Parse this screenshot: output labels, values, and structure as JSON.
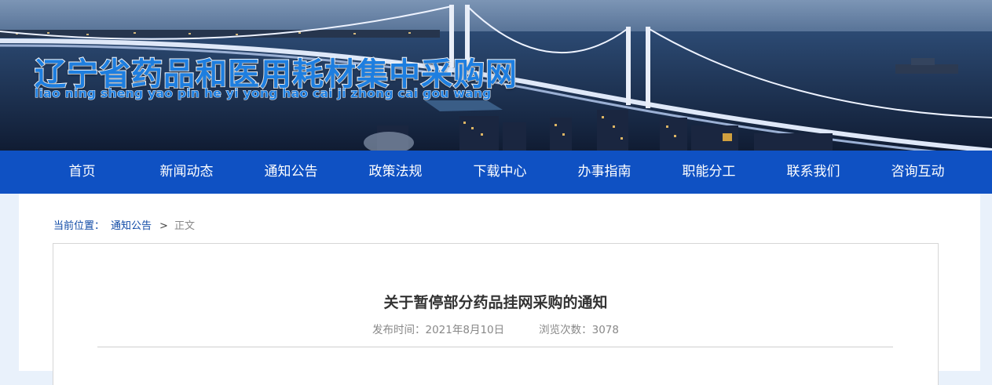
{
  "site": {
    "title": "辽宁省药品和医用耗材集中采购网",
    "pinyin": "liao ning sheng yao pin he yi yong hao cai ji zhong cai gou wang"
  },
  "nav": {
    "items": [
      "首页",
      "新闻动态",
      "通知公告",
      "政策法规",
      "下载中心",
      "办事指南",
      "职能分工",
      "联系我们",
      "咨询互动"
    ]
  },
  "breadcrumb": {
    "label": "当前位置：",
    "link": "通知公告",
    "separator": ">",
    "current": "正文"
  },
  "article": {
    "title": "关于暂停部分药品挂网采购的通知",
    "publish_label": "发布时间：",
    "publish_date": "2021年8月10日",
    "views_label": "浏览次数：",
    "views": "3078"
  },
  "colors": {
    "nav_bg": "#0f51c3",
    "title_blue": "#1d7ee0",
    "link_blue": "#0f4aa6",
    "page_bg": "#e9f1fb"
  }
}
